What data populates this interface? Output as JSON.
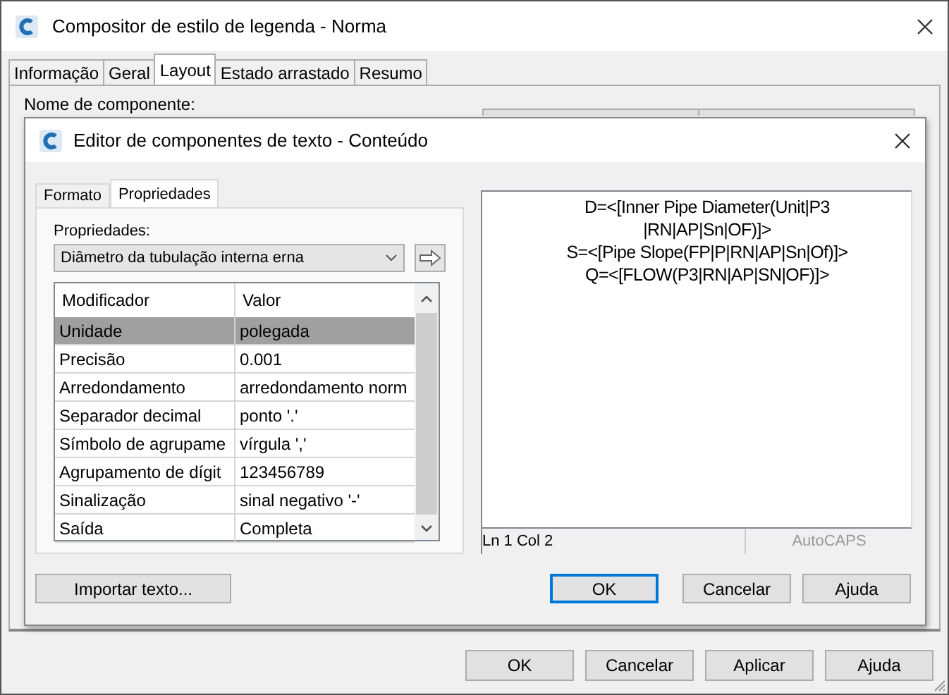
{
  "main_window": {
    "title": "Compositor de estilo de legenda - Norma",
    "tabs": [
      {
        "label": "Informação",
        "selected": false
      },
      {
        "label": "Geral",
        "selected": false
      },
      {
        "label": "Layout",
        "selected": true
      },
      {
        "label": "Estado arrastado",
        "selected": false
      },
      {
        "label": "Resumo",
        "selected": false
      }
    ],
    "field_label": "Nome de componente:",
    "buttons": [
      "OK",
      "Cancelar",
      "Aplicar",
      "Ajuda"
    ]
  },
  "editor_dialog": {
    "title": "Editor de componentes de texto - Conteúdo",
    "tabs": [
      {
        "label": "Formato",
        "selected": false
      },
      {
        "label": "Propriedades",
        "selected": true
      }
    ],
    "properties_label": "Propriedades:",
    "properties_value": "Diâmetro da tubulação interna erna",
    "columns": [
      "Modificador",
      "Valor"
    ],
    "rows": [
      {
        "modifier": "Unidade",
        "value": "polegada",
        "selected": true
      },
      {
        "modifier": "Precisão",
        "value": "0.001",
        "selected": false
      },
      {
        "modifier": "Arredondamento",
        "value": "arredondamento norm",
        "selected": false
      },
      {
        "modifier": "Separador decimal",
        "value": "ponto '.'",
        "selected": false
      },
      {
        "modifier": "Símbolo de agrupame",
        "value": "vírgula ','",
        "selected": false
      },
      {
        "modifier": "Agrupamento de dígit",
        "value": "123456789",
        "selected": false
      },
      {
        "modifier": "Sinalização",
        "value": "sinal negativo '-'",
        "selected": false
      },
      {
        "modifier": "Saída",
        "value": "Completa",
        "selected": false
      }
    ],
    "content_lines": [
      "D=<[Inner Pipe Diameter(Unit|P3",
      "|RN|AP|Sn|OF)]>",
      "S=<[Pipe Slope(FP|P|RN|AP|Sn|Of)]>",
      "Q=<[FLOW(P3|RN|AP|SN|OF)]>"
    ],
    "status": {
      "position": "Ln 1 Col 2",
      "mode": "AutoCAPS"
    },
    "buttons": [
      {
        "label": "Importar texto...",
        "default": false
      },
      {
        "label": "OK",
        "default": true
      },
      {
        "label": "Cancelar",
        "default": false
      },
      {
        "label": "Ajuda",
        "default": false
      }
    ]
  }
}
